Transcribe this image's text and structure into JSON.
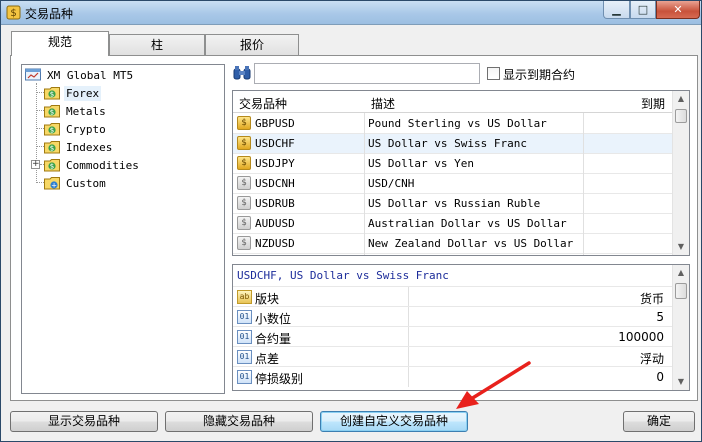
{
  "window": {
    "title": "交易品种"
  },
  "tabs": [
    {
      "label": "规范",
      "active": true
    },
    {
      "label": "柱",
      "active": false
    },
    {
      "label": "报价",
      "active": false
    }
  ],
  "tree": {
    "root": "XM Global MT5",
    "items": [
      {
        "label": "Forex",
        "selected": true
      },
      {
        "label": "Metals"
      },
      {
        "label": "Crypto"
      },
      {
        "label": "Indexes"
      },
      {
        "label": "Commodities",
        "expandable": true
      },
      {
        "label": "Custom"
      }
    ]
  },
  "search": {
    "value": "",
    "placeholder": ""
  },
  "show_expired": {
    "label": "显示到期合约",
    "checked": false
  },
  "grid": {
    "columns": [
      "交易品种",
      "描述",
      "到期"
    ],
    "rows": [
      {
        "symbol": "GBPUSD",
        "description": "Pound Sterling vs US Dollar",
        "expiry": "",
        "icon": "gold"
      },
      {
        "symbol": "USDCHF",
        "description": "US Dollar vs Swiss Franc",
        "expiry": "",
        "icon": "gold",
        "selected": true
      },
      {
        "symbol": "USDJPY",
        "description": "US Dollar vs Yen",
        "expiry": "",
        "icon": "gold"
      },
      {
        "symbol": "USDCNH",
        "description": "USD/CNH",
        "expiry": "",
        "icon": "grey"
      },
      {
        "symbol": "USDRUB",
        "description": "US Dollar vs Russian Ruble",
        "expiry": "",
        "icon": "grey"
      },
      {
        "symbol": "AUDUSD",
        "description": "Australian Dollar vs US Dollar",
        "expiry": "",
        "icon": "grey"
      },
      {
        "symbol": "NZDUSD",
        "description": "New Zealand Dollar vs US Dollar",
        "expiry": "",
        "icon": "grey"
      }
    ]
  },
  "properties": {
    "title": "USDCHF, US Dollar vs Swiss Franc",
    "rows": [
      {
        "icon": "ab",
        "name": "版块",
        "value": "货币"
      },
      {
        "icon": "01",
        "name": "小数位",
        "value": "5"
      },
      {
        "icon": "01",
        "name": "合约量",
        "value": "100000"
      },
      {
        "icon": "01",
        "name": "点差",
        "value": "浮动"
      },
      {
        "icon": "01",
        "name": "停损级别",
        "value": "0"
      }
    ]
  },
  "buttons": {
    "show": "显示交易品种",
    "hide": "隐藏交易品种",
    "create_custom": "创建自定义交易品种",
    "ok": "确定"
  },
  "colors": {
    "selection": "#eaf3fc",
    "annotation_arrow": "#e8211c",
    "props_title": "#1c2c9a"
  }
}
